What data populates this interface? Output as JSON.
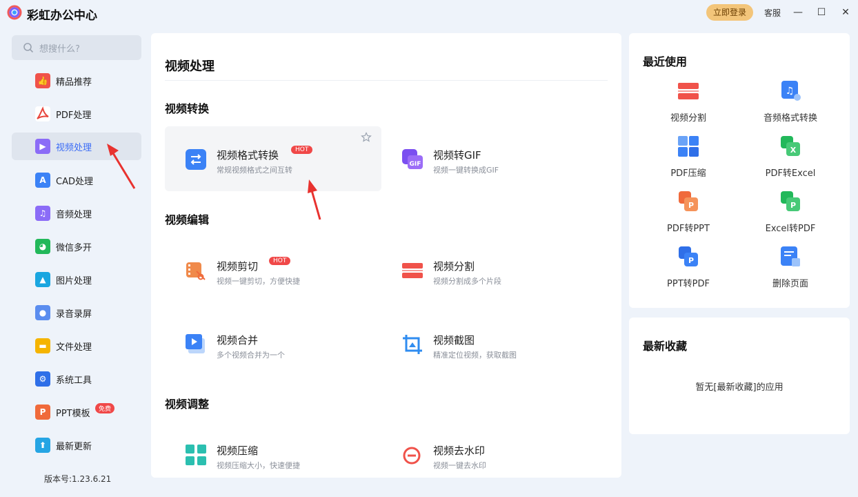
{
  "app": {
    "title": "彩虹办公中心",
    "login_label": "立即登录",
    "service_label": "客服"
  },
  "sidebar": {
    "search_placeholder": "想搜什么?",
    "items": [
      {
        "label": "精品推荐",
        "color": "#f0524a"
      },
      {
        "label": "PDF处理",
        "color": "#e8453c"
      },
      {
        "label": "视频处理",
        "color": "#8b6cf7"
      },
      {
        "label": "CAD处理",
        "color": "#3b82f6"
      },
      {
        "label": "音频处理",
        "color": "#8b6cf7"
      },
      {
        "label": "微信多开",
        "color": "#22b85a"
      },
      {
        "label": "图片处理",
        "color": "#1aa6e0"
      },
      {
        "label": "录音录屏",
        "color": "#5b8def"
      },
      {
        "label": "文件处理",
        "color": "#f5b400"
      },
      {
        "label": "系统工具",
        "color": "#2f6fe8"
      },
      {
        "label": "PPT模板",
        "color": "#f06a3b",
        "badge": "免费"
      },
      {
        "label": "最新更新",
        "color": "#26a5e4"
      }
    ],
    "version": "版本号:1.23.6.21"
  },
  "main": {
    "title": "视频处理",
    "sections": [
      {
        "title": "视频转换",
        "cards": [
          {
            "name": "视频格式转换",
            "desc": "常规视频格式之间互转",
            "hot": "HOT"
          },
          {
            "name": "视频转GIF",
            "desc": "视频一键转换成GIF",
            "icon_text": "GIF"
          }
        ]
      },
      {
        "title": "视频编辑",
        "cards": [
          {
            "name": "视频剪切",
            "desc": "视频一键剪切，方便快捷",
            "hot": "HOT"
          },
          {
            "name": "视频分割",
            "desc": "视频分割成多个片段"
          },
          {
            "name": "视频合并",
            "desc": "多个视频合并为一个"
          },
          {
            "name": "视频截图",
            "desc": "精准定位视频，获取截图"
          }
        ]
      },
      {
        "title": "视频调整",
        "cards": [
          {
            "name": "视频压缩",
            "desc": "视频压缩大小，快速便捷"
          },
          {
            "name": "视频去水印",
            "desc": "视频一键去水印"
          }
        ]
      }
    ]
  },
  "recent": {
    "title": "最近使用",
    "tools": [
      {
        "label": "视频分割"
      },
      {
        "label": "音频格式转换"
      },
      {
        "label": "PDF压缩"
      },
      {
        "label": "PDF转Excel"
      },
      {
        "label": "PDF转PPT",
        "icon_text": "P"
      },
      {
        "label": "Excel转PDF",
        "icon_text": "P"
      },
      {
        "label": "PPT转PDF",
        "icon_text": "P"
      },
      {
        "label": "删除页面"
      }
    ]
  },
  "favorites": {
    "title": "最新收藏",
    "empty_text": "暂无[最新收藏]的应用"
  }
}
